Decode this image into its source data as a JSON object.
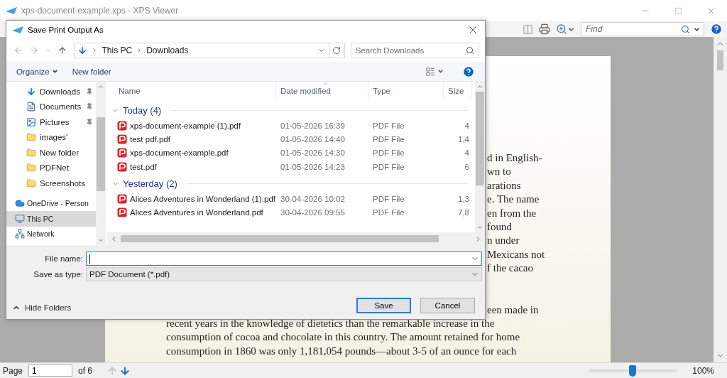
{
  "window": {
    "title": "xps-document-example.xps - XPS Viewer"
  },
  "toolbar": {
    "find": {
      "placeholder": "Find"
    }
  },
  "document": {
    "paragraphs": [
      {
        "lines": [
          {
            "kind": "fragment",
            "text": "d in English-"
          },
          {
            "kind": "fragment",
            "text": "wn to"
          },
          {
            "kind": "fragment",
            "text": "arations"
          },
          {
            "kind": "fragment",
            "text": "e. The name"
          },
          {
            "kind": "fragment",
            "text": "en from the"
          },
          {
            "kind": "fragment",
            "text": "found"
          },
          {
            "kind": "fragment",
            "text": "n under"
          },
          {
            "kind": "fragment",
            "text": "Mexicans not"
          },
          {
            "kind": "fragment",
            "text": "f the cacao"
          }
        ]
      },
      {
        "lines": [
          {
            "kind": "fragment",
            "text": "een made in"
          },
          {
            "kind": "full",
            "text": "recent years in the knowledge of dietetics than the remarkable increase in the"
          },
          {
            "kind": "full",
            "text": "consumption of cocoa and chocolate in this country. The amount retained for home"
          },
          {
            "kind": "full",
            "text": "consumption in 1860 was only 1,181,054 pounds—about 3-5 of an ounce for each"
          }
        ]
      }
    ]
  },
  "status_bar": {
    "page_label": "Page",
    "page_value": "1",
    "page_count": "of 6",
    "previous_disabled": true,
    "next_disabled": false,
    "zoom": {
      "level": 0.5,
      "reading": "100%"
    }
  },
  "dialog": {
    "title": "Save Print Output As",
    "breadcrumb": [
      "This PC",
      "Downloads"
    ],
    "search": {
      "placeholder": "Search Downloads"
    },
    "commands": [
      {
        "label": "Organize",
        "menu": true
      },
      {
        "label": "New folder",
        "menu": false
      }
    ],
    "nav_items": [
      {
        "label": "Downloads",
        "kind": "download",
        "pinned": true,
        "selected": false
      },
      {
        "label": "Documents",
        "kind": "document",
        "pinned": true,
        "selected": false
      },
      {
        "label": "Pictures",
        "kind": "picture",
        "pinned": true,
        "selected": false
      },
      {
        "label": "images'",
        "kind": "folder",
        "pinned": false,
        "selected": false
      },
      {
        "label": "New folder",
        "kind": "folder",
        "pinned": false,
        "selected": false
      },
      {
        "label": "PDFNet",
        "kind": "folder",
        "pinned": false,
        "selected": false
      },
      {
        "label": "Screenshots",
        "kind": "folder",
        "pinned": false,
        "selected": false
      },
      {
        "label": "OneDrive - Person",
        "kind": "cloud",
        "pinned": false,
        "selected": false
      },
      {
        "label": "This PC",
        "kind": "computer",
        "pinned": false,
        "selected": true
      },
      {
        "label": "Network",
        "kind": "network",
        "pinned": false,
        "selected": false
      }
    ],
    "columns": [
      {
        "label": "Name",
        "sorted": false
      },
      {
        "label": "Date modified",
        "sorted": true
      },
      {
        "label": "Type",
        "sorted": false
      },
      {
        "label": "Size",
        "sorted": false
      }
    ],
    "groups": [
      {
        "label": "Today (4)",
        "expanded": true,
        "files": [
          {
            "name": "xps-document-example (1).pdf",
            "date": "01-05-2026 16:39",
            "type": "PDF File",
            "size": "4"
          },
          {
            "name": "test pdf.pdf",
            "date": "01-05-2026 14:40",
            "type": "PDF File",
            "size": "1,4"
          },
          {
            "name": "xps-document-example.pdf",
            "date": "01-05-2026 14:30",
            "type": "PDF File",
            "size": "4"
          },
          {
            "name": "test.pdf",
            "date": "01-05-2026 14:23",
            "type": "PDF File",
            "size": "6"
          }
        ]
      },
      {
        "label": "Yesterday (2)",
        "expanded": true,
        "files": [
          {
            "name": "Alices Adventures in Wonderland (1).pdf",
            "date": "30-04-2026 10:02",
            "type": "PDF File",
            "size": "1,3"
          },
          {
            "name": "Alices Adventures in Wonderland.pdf",
            "date": "30-04-2026 09:55",
            "type": "PDF File",
            "size": "7,8"
          }
        ]
      }
    ],
    "file_name": {
      "label": "File name:",
      "focused": true
    },
    "save_as_type": {
      "label": "Save as type:",
      "value": "PDF Document (*.pdf)"
    },
    "buttons": [
      {
        "label": "Save",
        "default": true
      },
      {
        "label": "Cancel",
        "default": false
      }
    ],
    "hide_folders": "Hide Folders"
  }
}
